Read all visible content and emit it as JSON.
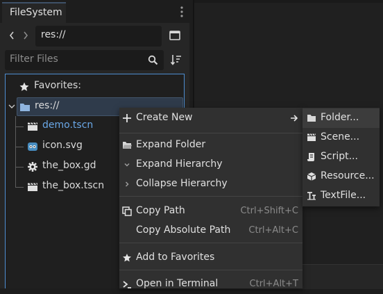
{
  "dock": {
    "tab_label": "FileSystem",
    "path_value": "res://",
    "filter_placeholder": "Filter Files",
    "tree": {
      "favorites_label": "Favorites:",
      "root_label": "res://",
      "files": [
        "demo.tscn",
        "icon.svg",
        "the_box.gd",
        "the_box.tscn"
      ]
    }
  },
  "context_menu": {
    "items": [
      {
        "label": "Create New",
        "shortcut": ""
      },
      {
        "label": "Expand Folder",
        "shortcut": ""
      },
      {
        "label": "Expand Hierarchy",
        "shortcut": ""
      },
      {
        "label": "Collapse Hierarchy",
        "shortcut": ""
      },
      {
        "label": "Copy Path",
        "shortcut": "Ctrl+Shift+C"
      },
      {
        "label": "Copy Absolute Path",
        "shortcut": "Ctrl+Alt+C"
      },
      {
        "label": "Add to Favorites",
        "shortcut": ""
      },
      {
        "label": "Open in Terminal",
        "shortcut": "Ctrl+Alt+T"
      }
    ]
  },
  "submenu": {
    "items": [
      {
        "label": "Folder..."
      },
      {
        "label": "Scene..."
      },
      {
        "label": "Script..."
      },
      {
        "label": "Resource..."
      },
      {
        "label": "TextFile..."
      }
    ]
  },
  "colors": {
    "accent": "#4e8ed1",
    "scene_file_text": "#6aa8e8",
    "menu_bg": "#303030",
    "panel_bg": "#262626"
  }
}
